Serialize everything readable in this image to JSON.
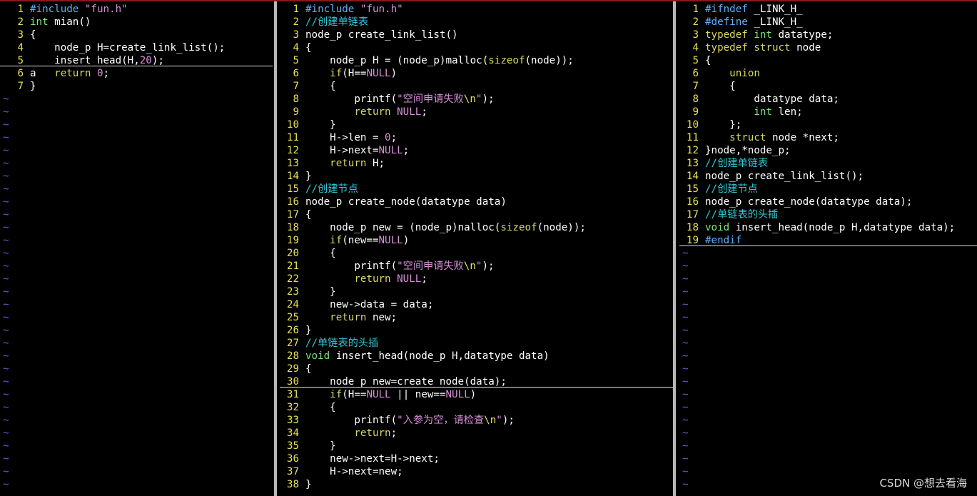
{
  "window": {
    "layout": "vim-three-vertical-splits"
  },
  "panes": [
    {
      "id": "main.c",
      "lines": [
        {
          "n": "1",
          "text": "#include \"fun.h\""
        },
        {
          "n": "2",
          "text": "int mian()"
        },
        {
          "n": "3",
          "text": "{"
        },
        {
          "n": "4",
          "text": "    node_p H=create_link_list();"
        },
        {
          "n": "5",
          "text": "    insert_head(H,20);"
        },
        {
          "n": "6",
          "text": "a   return 0;"
        },
        {
          "n": "7",
          "text": "}"
        }
      ],
      "tilde_count": 31
    },
    {
      "id": "fun.c",
      "lines": [
        {
          "n": "1",
          "text": "#include \"fun.h\""
        },
        {
          "n": "2",
          "text": "//创建单链表"
        },
        {
          "n": "3",
          "text": "node_p create_link_list()"
        },
        {
          "n": "4",
          "text": "{"
        },
        {
          "n": "5",
          "text": "    node_p H = (node_p)malloc(sizeof(node));"
        },
        {
          "n": "6",
          "text": "    if(H==NULL)"
        },
        {
          "n": "7",
          "text": "    {"
        },
        {
          "n": "8",
          "text": "        printf(\"空间申请失败\\n\");"
        },
        {
          "n": "9",
          "text": "        return NULL;"
        },
        {
          "n": "10",
          "text": "    }"
        },
        {
          "n": "11",
          "text": "    H->len = 0;"
        },
        {
          "n": "12",
          "text": "    H->next=NULL;"
        },
        {
          "n": "13",
          "text": "    return H;"
        },
        {
          "n": "14",
          "text": "}"
        },
        {
          "n": "15",
          "text": "//创建节点"
        },
        {
          "n": "16",
          "text": "node_p create_node(datatype data)"
        },
        {
          "n": "17",
          "text": "{"
        },
        {
          "n": "18",
          "text": "    node_p new = (node_p)nalloc(sizeof(node));"
        },
        {
          "n": "19",
          "text": "    if(new==NULL)"
        },
        {
          "n": "20",
          "text": "    {"
        },
        {
          "n": "21",
          "text": "        printf(\"空间申请失败\\n\");"
        },
        {
          "n": "22",
          "text": "        return NULL;"
        },
        {
          "n": "23",
          "text": "    }"
        },
        {
          "n": "24",
          "text": "    new->data = data;"
        },
        {
          "n": "25",
          "text": "    return new;"
        },
        {
          "n": "26",
          "text": "}"
        },
        {
          "n": "27",
          "text": "//单链表的头插"
        },
        {
          "n": "28",
          "text": "void insert_head(node_p H,datatype data)"
        },
        {
          "n": "29",
          "text": "{"
        },
        {
          "n": "30",
          "text": "    node_p new=create_node(data);"
        },
        {
          "n": "31",
          "text": "    if(H==NULL || new==NULL)"
        },
        {
          "n": "32",
          "text": "    {"
        },
        {
          "n": "33",
          "text": "        printf(\"入参为空，请检查\\n\");"
        },
        {
          "n": "34",
          "text": "        return;"
        },
        {
          "n": "35",
          "text": "    }"
        },
        {
          "n": "36",
          "text": "    new->next=H->next;"
        },
        {
          "n": "37",
          "text": "    H->next=new;"
        },
        {
          "n": "38",
          "text": "}"
        }
      ],
      "tilde_count": 0
    },
    {
      "id": "fun.h",
      "lines": [
        {
          "n": "1",
          "text": "#ifndef _LINK_H_"
        },
        {
          "n": "2",
          "text": "#define _LINK_H_"
        },
        {
          "n": "3",
          "text": "typedef int datatype;"
        },
        {
          "n": "4",
          "text": "typedef struct node"
        },
        {
          "n": "5",
          "text": "{"
        },
        {
          "n": "6",
          "text": "    union"
        },
        {
          "n": "7",
          "text": "    {"
        },
        {
          "n": "8",
          "text": "        datatype data;"
        },
        {
          "n": "9",
          "text": "        int len;"
        },
        {
          "n": "10",
          "text": "    };"
        },
        {
          "n": "11",
          "text": "    struct node *next;"
        },
        {
          "n": "12",
          "text": "}node,*node_p;"
        },
        {
          "n": "13",
          "text": "//创建单链表"
        },
        {
          "n": "14",
          "text": "node_p create_link_list();"
        },
        {
          "n": "15",
          "text": "//创建节点"
        },
        {
          "n": "16",
          "text": "node_p create_node(datatype data);"
        },
        {
          "n": "17",
          "text": "//单链表的头插"
        },
        {
          "n": "18",
          "text": "void insert_head(node_p H,datatype data);"
        },
        {
          "n": "19",
          "text": "#endif"
        }
      ],
      "tilde_count": 19
    }
  ],
  "watermark": "CSDN @想去看海",
  "colors": {
    "line_number": "#e8e05a",
    "comment": "#34c6d6",
    "preproc": "#5fafff",
    "keyword": "#d7d75f",
    "type": "#7ee37e",
    "string": "#d78fd7",
    "escape": "#e8e05a",
    "tilde": "#5f5fd7",
    "normal": "#ffffff"
  }
}
